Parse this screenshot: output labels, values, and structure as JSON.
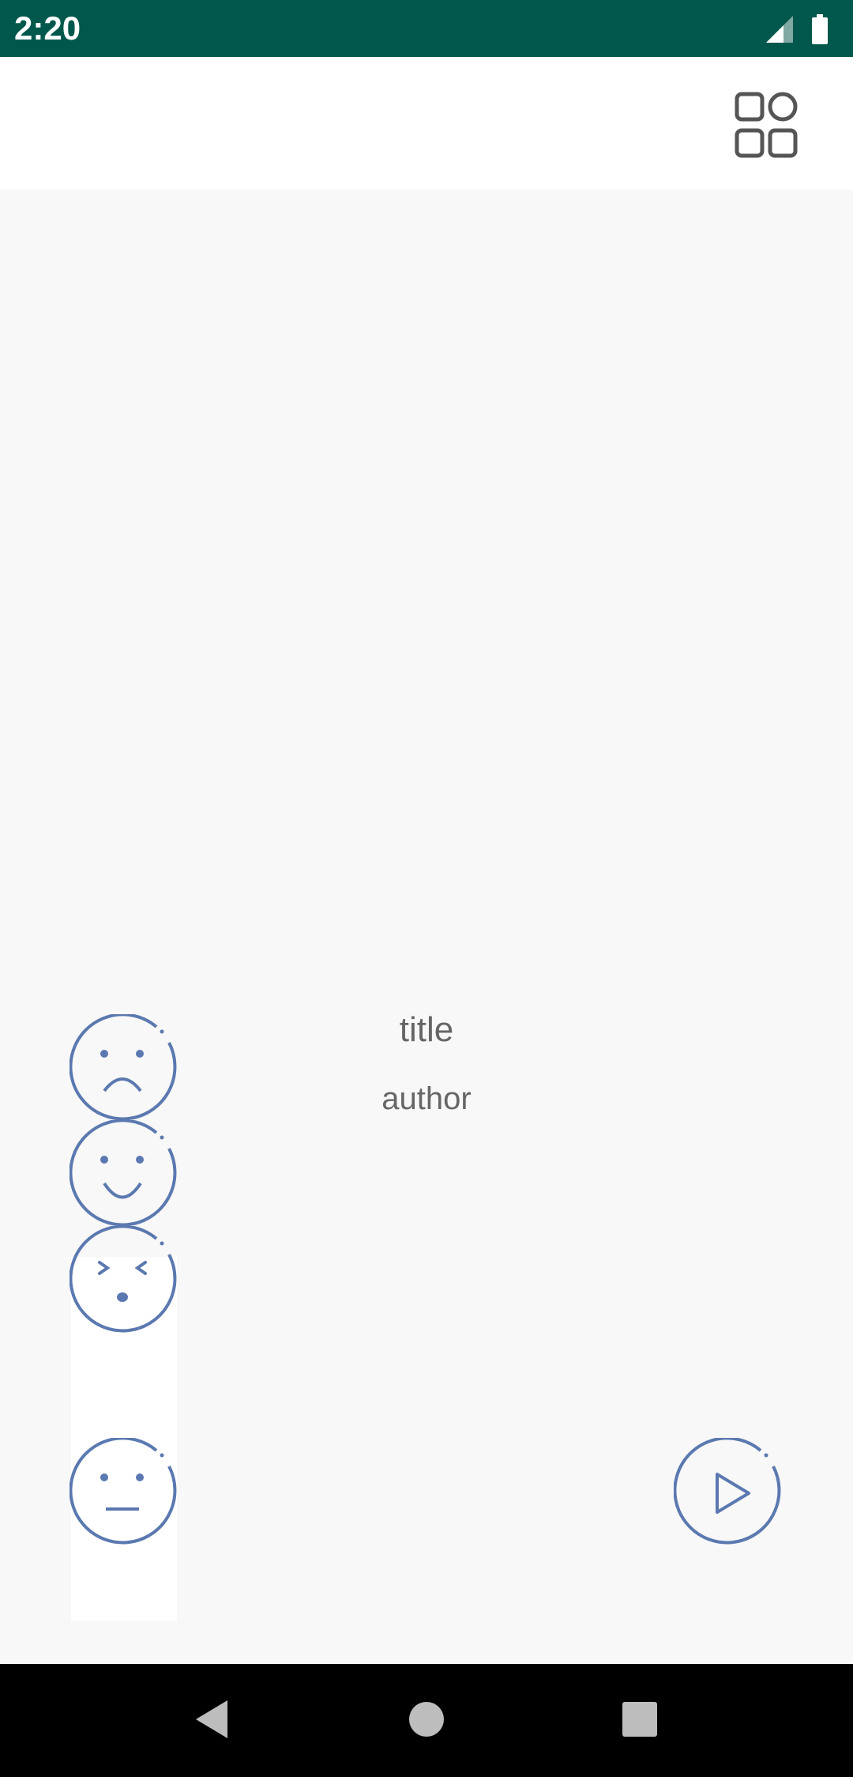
{
  "status_bar": {
    "time": "2:20",
    "icons": [
      "signal-icon",
      "battery-icon"
    ],
    "background": "#00574b"
  },
  "app_bar": {
    "action_icon": "grid-view-icon"
  },
  "book": {
    "title": "title",
    "author": "author"
  },
  "mood_faces": [
    "sad-face-icon",
    "happy-face-icon",
    "dizzy-face-icon",
    "neutral-face-icon"
  ],
  "player": {
    "play_icon": "play-icon"
  },
  "nav_bar": {
    "buttons": [
      "back-icon",
      "home-icon",
      "recents-icon"
    ]
  },
  "colors": {
    "accent": "#5b79b0",
    "text": "#666666",
    "background": "#f8f8f8"
  }
}
